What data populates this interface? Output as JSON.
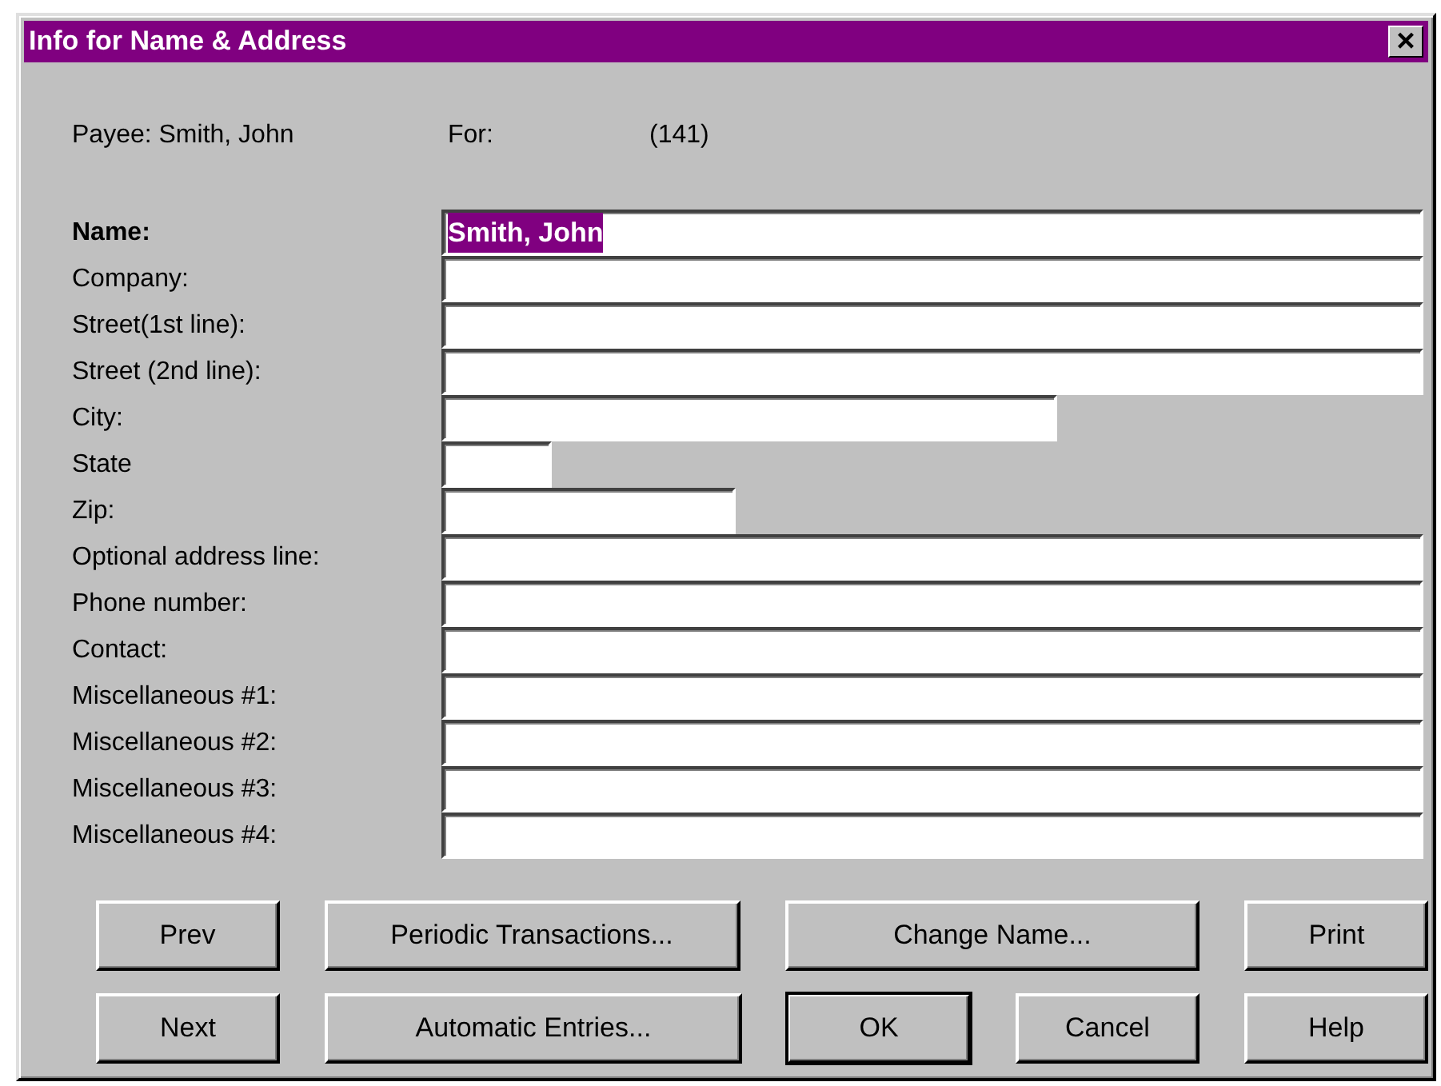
{
  "window": {
    "title": "Info for Name & Address",
    "close_glyph": "×"
  },
  "header": {
    "payee": "Payee: Smith, John",
    "for_label": "For:",
    "for_value": "(141)"
  },
  "fields": [
    {
      "label": "Name:",
      "kind": "full",
      "bold": true,
      "value": "Smith, John",
      "text_selected": true
    },
    {
      "label": "Company:",
      "kind": "full",
      "bold": false
    },
    {
      "label": "Street(1st line):",
      "kind": "full",
      "bold": false
    },
    {
      "label": "Street (2nd line):",
      "kind": "full",
      "bold": false
    },
    {
      "label": "City:",
      "kind": "city",
      "bold": false
    },
    {
      "label": "State",
      "kind": "state",
      "bold": false
    },
    {
      "label": "Zip:",
      "kind": "zip",
      "bold": false
    },
    {
      "label": "Optional address line:",
      "kind": "full",
      "bold": false
    },
    {
      "label": "Phone number:",
      "kind": "full",
      "bold": false
    },
    {
      "label": "Contact:",
      "kind": "full",
      "bold": false
    },
    {
      "label": "Miscellaneous #1:",
      "kind": "full",
      "bold": false
    },
    {
      "label": "Miscellaneous #2:",
      "kind": "full",
      "bold": false
    },
    {
      "label": "Miscellaneous #3:",
      "kind": "full",
      "bold": false
    },
    {
      "label": "Miscellaneous #4:",
      "kind": "full",
      "bold": false
    }
  ],
  "button_rows": [
    [
      {
        "label": "Prev",
        "kind": "small",
        "default": false
      },
      {
        "label": "Periodic Transactions...",
        "kind": "wide",
        "default": false
      },
      {
        "label": "Change Name...",
        "kind": "wide",
        "default": false
      },
      {
        "label": "Print",
        "kind": "small",
        "default": false
      }
    ],
    [
      {
        "label": "Next",
        "kind": "small",
        "default": false
      },
      {
        "label": "Automatic Entries...",
        "kind": "wide",
        "default": false
      },
      {
        "label": "OK",
        "kind": "small",
        "default": true
      },
      {
        "label": "Cancel",
        "kind": "small",
        "default": false
      },
      {
        "label": "Help",
        "kind": "small",
        "default": false
      }
    ]
  ]
}
